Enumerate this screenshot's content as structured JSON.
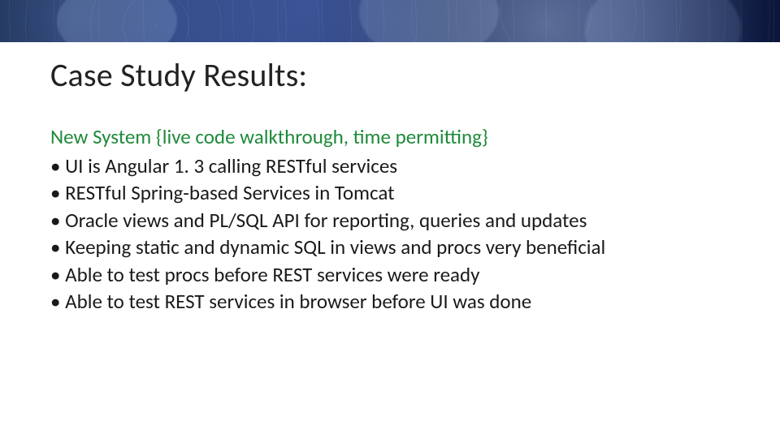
{
  "title": "Case Study Results:",
  "subhead": "New System {live code walkthrough, time permitting}",
  "bullets": [
    "• UI is Angular 1. 3 calling RESTful services",
    "• RESTful Spring-based Services in Tomcat",
    "• Oracle views and PL/SQL API for reporting, queries and updates",
    "• Keeping static and dynamic SQL in views and procs very beneficial",
    "• Able to test procs before REST services were ready",
    "• Able to test REST services in browser before UI was done"
  ]
}
